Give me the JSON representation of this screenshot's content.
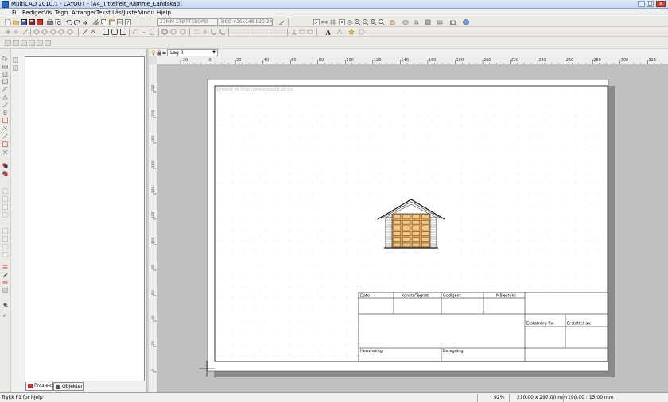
{
  "window": {
    "title": "MultiCAD 2010.1 - LAYOUT - [A4_Tittelfelt_Ramme_Landskap]",
    "minimize_label": "_",
    "maximize_label": "□",
    "close_label": "x"
  },
  "menu": [
    "Fil",
    "Rediger",
    "Vis",
    "Tegn",
    "Arranger",
    "Tekst",
    "Lås/Juster",
    "Vindu",
    "Hjelp"
  ],
  "toolbar": {
    "combo_wall": "23MM STØTTEBORD",
    "combo_beam": "DCO v36x148 b23 2X-"
  },
  "layer": {
    "selected": "Lag 0"
  },
  "rulers": {
    "top": [
      "-20",
      "0",
      "20",
      "40",
      "60",
      "80",
      "100",
      "120",
      "140",
      "160",
      "180",
      "200",
      "220",
      "240",
      "260",
      "280",
      "300",
      "323"
    ],
    "left": [
      "220",
      "200",
      "180",
      "160",
      "140",
      "120",
      "100",
      "80",
      "60",
      "40",
      "20",
      "0"
    ]
  },
  "sheet": {
    "watermark": "Printed by http://www.multicad.no"
  },
  "title_block": {
    "dato": "Dato",
    "konstr": "Konstr/Tegnet",
    "godkjent": "Godkjent",
    "malestokk": "Målestokk",
    "erstatning_for": "Erstatning for:",
    "erstattet_av": "Erstattet av:",
    "henvisning": "Henvisning:",
    "beregning": "Beregning:"
  },
  "tabs": {
    "project": "Prosjekt",
    "objects": "Objekter"
  },
  "status": {
    "help": "Trykk F1 for hjelp",
    "zoom": "92%",
    "paper": "210.00 x 297.00 mm",
    "scale": "190.00 : 15.00 mm"
  },
  "colors": {
    "accent": "#2a6bc9",
    "garage_door": "#e2a45a",
    "canvas_bg": "#c0c0c0"
  }
}
